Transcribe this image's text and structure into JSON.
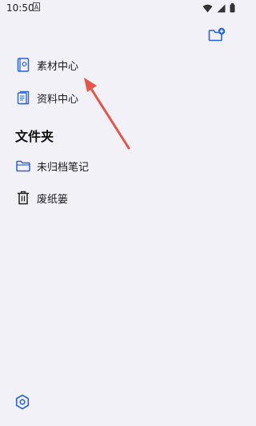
{
  "status_bar": {
    "time": "10:50",
    "icons": [
      "notification-a-icon",
      "wifi-icon",
      "signal-icon",
      "battery-icon"
    ]
  },
  "toolbar": {
    "new_folder_icon": "new-folder-icon"
  },
  "nav": {
    "items": [
      {
        "label": "素材中心",
        "icon": "material-book-icon"
      },
      {
        "label": "资料中心",
        "icon": "document-icon"
      }
    ]
  },
  "folders": {
    "title": "文件夹",
    "items": [
      {
        "label": "未归档笔记",
        "icon": "folder-icon"
      },
      {
        "label": "废纸篓",
        "icon": "trash-icon"
      }
    ]
  },
  "footer": {
    "settings_icon": "settings-icon"
  },
  "colors": {
    "accent": "#2b63d6",
    "background": "#f1f1f7",
    "annotation_arrow": "#e4564a"
  }
}
